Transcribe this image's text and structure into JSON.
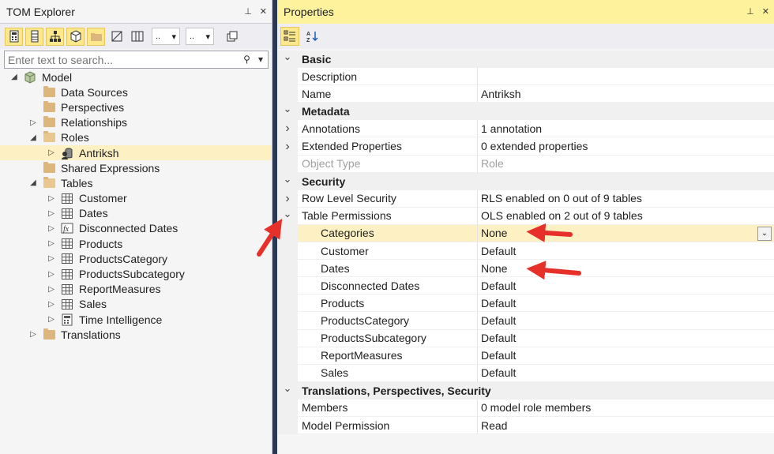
{
  "tom": {
    "title": "TOM Explorer",
    "pin": "📌",
    "close": "✕",
    "dd1": "..",
    "dd2": "..",
    "search_placeholder": "Enter text to search...",
    "tree": [
      {
        "label": "Model",
        "level": 0,
        "arrow": "◢",
        "icon": "model-icon"
      },
      {
        "label": "Data Sources",
        "level": 1,
        "arrow": "",
        "icon": "folder-icon"
      },
      {
        "label": "Perspectives",
        "level": 1,
        "arrow": "",
        "icon": "folder-icon"
      },
      {
        "label": "Relationships",
        "level": 1,
        "arrow": "▷",
        "icon": "folder-icon"
      },
      {
        "label": "Roles",
        "level": 1,
        "arrow": "◢",
        "icon": "folder-open-icon"
      },
      {
        "label": "Antriksh",
        "level": 2,
        "arrow": "▷",
        "icon": "role-icon",
        "selected": true
      },
      {
        "label": "Shared Expressions",
        "level": 1,
        "arrow": "",
        "icon": "folder-icon"
      },
      {
        "label": "Tables",
        "level": 1,
        "arrow": "◢",
        "icon": "folder-open-icon"
      },
      {
        "label": "Customer",
        "level": 2,
        "arrow": "▷",
        "icon": "table-icon"
      },
      {
        "label": "Dates",
        "level": 2,
        "arrow": "▷",
        "icon": "table-icon"
      },
      {
        "label": "Disconnected Dates",
        "level": 2,
        "arrow": "▷",
        "icon": "calc-table-icon"
      },
      {
        "label": "Products",
        "level": 2,
        "arrow": "▷",
        "icon": "table-icon"
      },
      {
        "label": "ProductsCategory",
        "level": 2,
        "arrow": "▷",
        "icon": "table-icon"
      },
      {
        "label": "ProductsSubcategory",
        "level": 2,
        "arrow": "▷",
        "icon": "table-icon"
      },
      {
        "label": "ReportMeasures",
        "level": 2,
        "arrow": "▷",
        "icon": "table-icon"
      },
      {
        "label": "Sales",
        "level": 2,
        "arrow": "▷",
        "icon": "table-icon"
      },
      {
        "label": "Time Intelligence",
        "level": 2,
        "arrow": "▷",
        "icon": "calc-group-icon"
      },
      {
        "label": "Translations",
        "level": 1,
        "arrow": "▷",
        "icon": "folder-icon"
      }
    ]
  },
  "props": {
    "title": "Properties",
    "pin": "📌",
    "close": "✕",
    "rows": [
      {
        "type": "cat",
        "name": "Basic",
        "gut": "⌄"
      },
      {
        "type": "prop",
        "name": "Description",
        "value": ""
      },
      {
        "type": "prop",
        "name": "Name",
        "value": "Antriksh"
      },
      {
        "type": "cat",
        "name": "Metadata",
        "gut": "⌄"
      },
      {
        "type": "prop",
        "name": "Annotations",
        "value": "1 annotation",
        "gut": "›"
      },
      {
        "type": "prop",
        "name": "Extended Properties",
        "value": "0 extended properties",
        "gut": "›"
      },
      {
        "type": "prop",
        "name": "Object Type",
        "value": "Role",
        "disabled": true
      },
      {
        "type": "cat",
        "name": "Security",
        "gut": "⌄"
      },
      {
        "type": "prop",
        "name": "Row Level Security",
        "value": "RLS enabled on 0 out of 9 tables",
        "gut": "›"
      },
      {
        "type": "prop",
        "name": "Table Permissions",
        "value": "OLS enabled on 2 out of 9 tables",
        "gut": "⌄"
      },
      {
        "type": "sub",
        "name": "Categories",
        "value": "None",
        "highlight": true,
        "combo": true
      },
      {
        "type": "sub",
        "name": "Customer",
        "value": "Default"
      },
      {
        "type": "sub",
        "name": "Dates",
        "value": "None"
      },
      {
        "type": "sub",
        "name": "Disconnected Dates",
        "value": "Default"
      },
      {
        "type": "sub",
        "name": "Products",
        "value": "Default"
      },
      {
        "type": "sub",
        "name": "ProductsCategory",
        "value": "Default"
      },
      {
        "type": "sub",
        "name": "ProductsSubcategory",
        "value": "Default"
      },
      {
        "type": "sub",
        "name": "ReportMeasures",
        "value": "Default"
      },
      {
        "type": "sub",
        "name": "Sales",
        "value": "Default"
      },
      {
        "type": "cat",
        "name": "Translations, Perspectives, Security",
        "gut": "⌄"
      },
      {
        "type": "prop",
        "name": "Members",
        "value": "0 model role members"
      },
      {
        "type": "prop",
        "name": "Model Permission",
        "value": "Read"
      }
    ]
  },
  "colors": {
    "chrome": "#293955",
    "title_active": "#fff29d",
    "selection": "#fdf1c4",
    "annotation_arrow": "#e8302a"
  }
}
